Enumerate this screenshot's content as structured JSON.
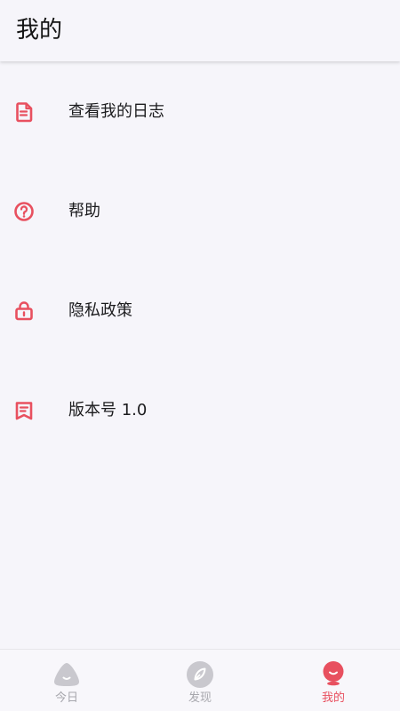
{
  "header": {
    "title": "我的"
  },
  "menu": {
    "items": [
      {
        "icon": "document-icon",
        "label": "查看我的日志"
      },
      {
        "icon": "help-circle-icon",
        "label": "帮助"
      },
      {
        "icon": "lock-icon",
        "label": "隐私政策"
      },
      {
        "icon": "version-bookmark-icon",
        "label": "版本号 1.0"
      }
    ]
  },
  "tabbar": {
    "tabs": [
      {
        "label": "今日",
        "icon": "today-icon",
        "active": false
      },
      {
        "label": "发现",
        "icon": "discover-icon",
        "active": false
      },
      {
        "label": "我的",
        "icon": "profile-icon",
        "active": true
      }
    ]
  },
  "colors": {
    "accent": "#e8505f",
    "inactive": "#a7a7ad",
    "background": "#f6f5fa"
  }
}
